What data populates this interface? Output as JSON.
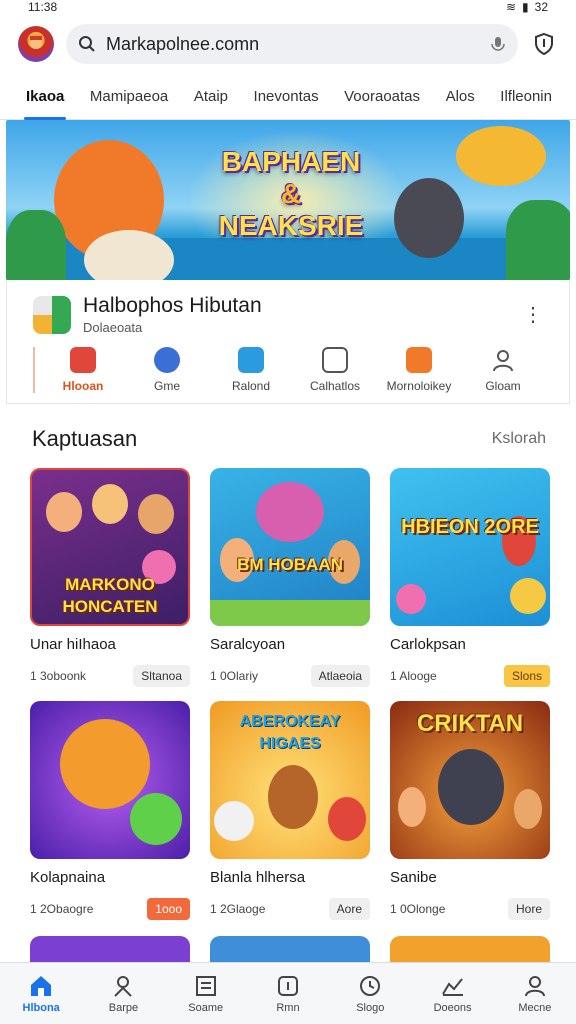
{
  "status": {
    "time": "11:38",
    "right": "32"
  },
  "header": {
    "url": "Markapolnee.comn"
  },
  "tabs": [
    {
      "label": "Ikaoa",
      "active": true
    },
    {
      "label": "Mamipaeoa"
    },
    {
      "label": "Ataip"
    },
    {
      "label": "Inevontas"
    },
    {
      "label": "Vooraoatas"
    },
    {
      "label": "Alos"
    },
    {
      "label": "Ilfleonin"
    }
  ],
  "banner": {
    "title_line1": "BAPHAEN",
    "title_amp": "&",
    "title_line2": "NEAKSRIE"
  },
  "app": {
    "name": "Halbophos Hibutan",
    "sub": "Dolaeoata"
  },
  "quick": [
    {
      "label": "Hlooan",
      "color": "#e0463a",
      "active": true
    },
    {
      "label": "Gme",
      "color": "#3c6fd6"
    },
    {
      "label": "Ralond",
      "color": "#2b9be0"
    },
    {
      "label": "Calhatlos",
      "color": "#555555"
    },
    {
      "label": "Mornoloikey",
      "color": "#f07a2a"
    },
    {
      "label": "Gloam",
      "color": "#555555"
    }
  ],
  "section": {
    "title": "Kaptuasan",
    "more": "Kslorah"
  },
  "games": [
    {
      "name": "Unar hiIhaoa",
      "size": "1 3oboonk",
      "badge": "Sltanoa",
      "badge_style": "grey",
      "thumb_title": "MARKONO HONCATEN",
      "bg": "#5b2a7a"
    },
    {
      "name": "Saralcyoan",
      "size": "1 0Olariy",
      "badge": "Atlaeoia",
      "badge_style": "grey",
      "thumb_title": "BM HOBAAN",
      "bg": "#2aa7d9"
    },
    {
      "name": "Carlokpsan",
      "size": "1 Alooge",
      "badge": "Slons",
      "badge_style": "orange",
      "thumb_title": "HBIEON 2ORE",
      "bg": "#1fa1e0"
    },
    {
      "name": "Kolapnaina",
      "size": "1 2Obaogre",
      "badge": "1ooo",
      "badge_style": "red",
      "thumb_title": "",
      "bg": "#6b2fc4"
    },
    {
      "name": "Blanla hlhersa",
      "size": "1 2Glaoge",
      "badge": "Aore",
      "badge_style": "grey",
      "thumb_title": "ABEROKEAY HIGAES",
      "bg": "#f5b32f"
    },
    {
      "name": "Sanibe",
      "size": "1 0Olonge",
      "badge": "Hore",
      "badge_style": "grey",
      "thumb_title": "CRIKTAN",
      "bg": "#d9571f"
    }
  ],
  "peek_colors": [
    "#7b3fd1",
    "#3f8ed9",
    "#f0a22c"
  ],
  "bottom_nav": [
    {
      "label": "Hlbona",
      "icon": "home-icon",
      "active": true
    },
    {
      "label": "Barpe",
      "icon": "person-pin-icon"
    },
    {
      "label": "Soame",
      "icon": "news-icon"
    },
    {
      "label": "Rmn",
      "icon": "info-icon"
    },
    {
      "label": "Slogo",
      "icon": "clock-icon"
    },
    {
      "label": "Doeons",
      "icon": "chart-icon"
    },
    {
      "label": "Mecne",
      "icon": "profile-icon"
    }
  ]
}
